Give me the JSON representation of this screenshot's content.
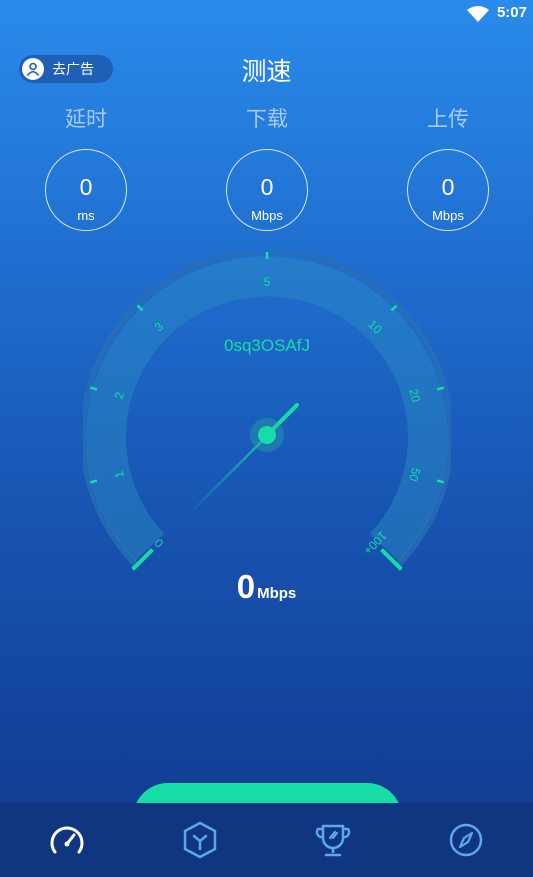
{
  "status_bar": {
    "time": "5:07"
  },
  "header": {
    "title": "测速",
    "ad_button_label": "去广告"
  },
  "metrics": [
    {
      "label": "延时",
      "value": "0",
      "unit": "ms"
    },
    {
      "label": "下载",
      "value": "0",
      "unit": "Mbps"
    },
    {
      "label": "上传",
      "value": "0",
      "unit": "Mbps"
    }
  ],
  "gauge": {
    "server_id": "0sq3OSAfJ",
    "scale_labels": [
      "0",
      "1",
      "2",
      "3",
      "5",
      "10",
      "20",
      "50",
      "100+"
    ],
    "speed_value": "0",
    "speed_unit": "Mbps",
    "colors": {
      "accent": "#16dca8",
      "track": "#2d8fc4",
      "ring": "#2a6fb5"
    }
  },
  "start_button": {
    "label": ""
  },
  "nav": {
    "items": [
      "speed-icon",
      "cube-icon",
      "trophy-icon",
      "compass-icon"
    ]
  }
}
